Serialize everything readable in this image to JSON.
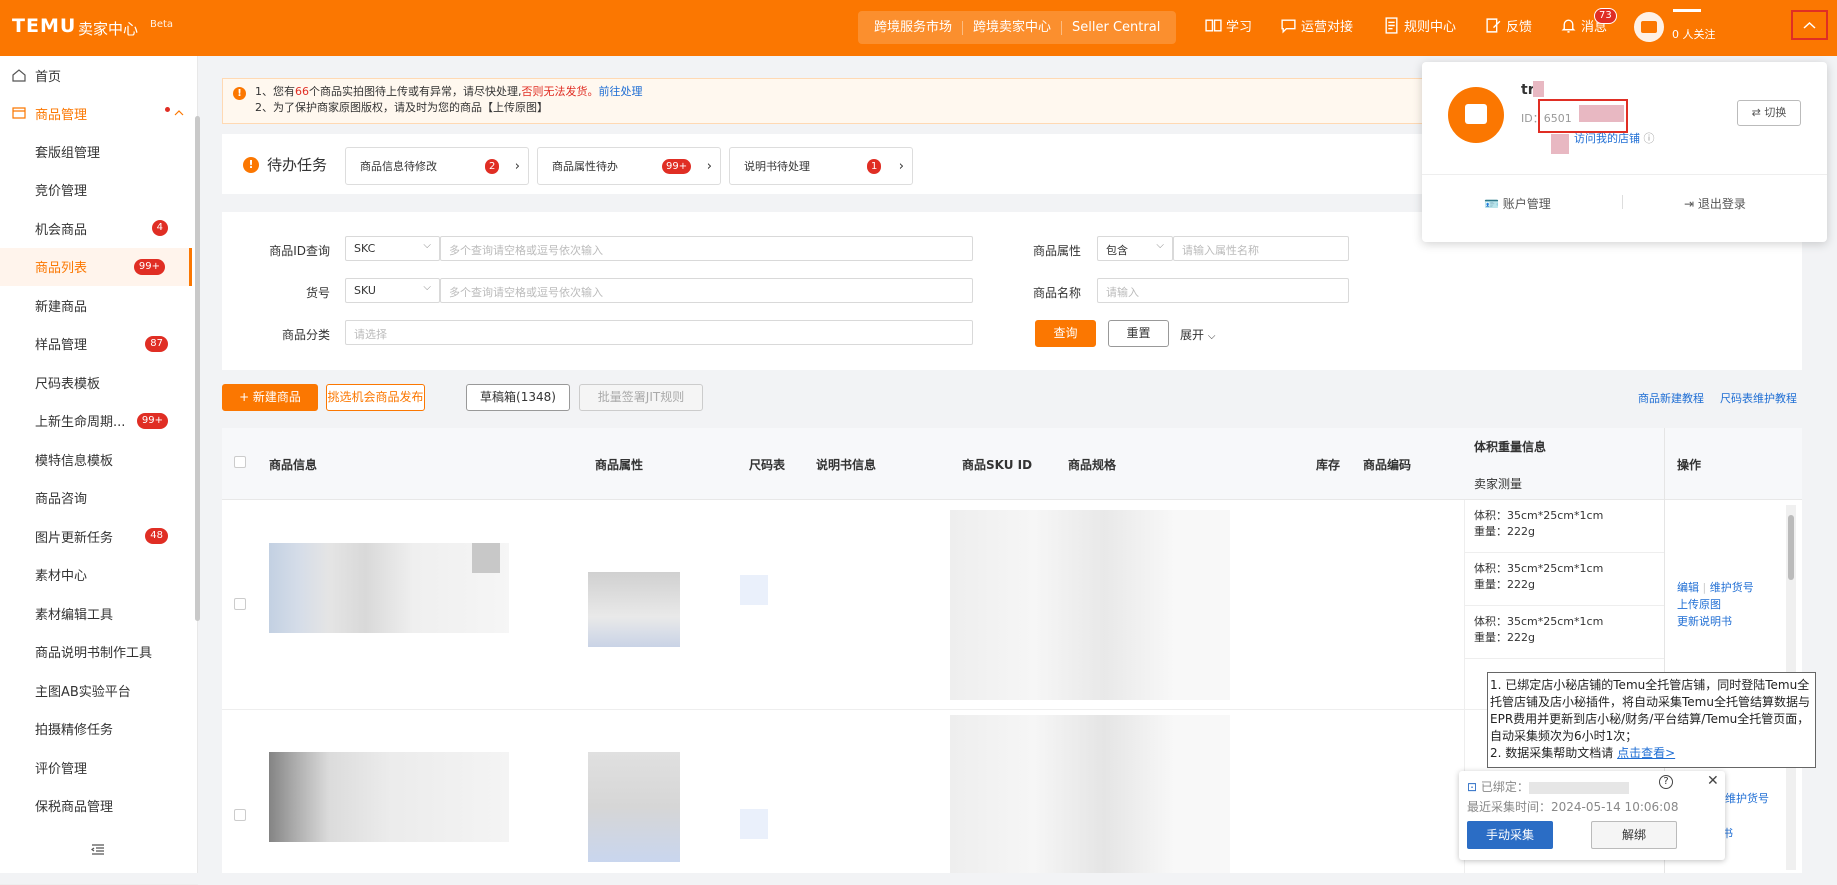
{
  "header": {
    "brand": "TEMU",
    "brand_sub": "卖家中心",
    "beta": "Beta",
    "links": [
      "跨境服务市场",
      "跨境卖家中心",
      "Seller Central"
    ],
    "nav": {
      "learn": "学习",
      "ops": "运营对接",
      "rules": "规则中心",
      "feedback": "反馈",
      "messages": "消息",
      "messages_count": "73"
    },
    "follow": "0 人关注"
  },
  "sidebar": {
    "home": "首页",
    "group": "商品管理",
    "items": [
      {
        "label": "套版组管理",
        "badge": ""
      },
      {
        "label": "竞价管理",
        "badge": ""
      },
      {
        "label": "机会商品",
        "badge": "4"
      },
      {
        "label": "商品列表",
        "badge": "99+"
      },
      {
        "label": "新建商品",
        "badge": ""
      },
      {
        "label": "样品管理",
        "badge": "87"
      },
      {
        "label": "尺码表模板",
        "badge": ""
      },
      {
        "label": "上新生命周期...",
        "badge": "99+"
      },
      {
        "label": "模特信息模板",
        "badge": ""
      },
      {
        "label": "商品咨询",
        "badge": ""
      },
      {
        "label": "图片更新任务",
        "badge": "48"
      },
      {
        "label": "素材中心",
        "badge": ""
      },
      {
        "label": "素材编辑工具",
        "badge": ""
      },
      {
        "label": "商品说明书制作工具",
        "badge": ""
      },
      {
        "label": "主图AB实验平台",
        "badge": ""
      },
      {
        "label": "拍摄精修任务",
        "badge": ""
      },
      {
        "label": "评价管理",
        "badge": ""
      },
      {
        "label": "保税商品管理",
        "badge": ""
      }
    ]
  },
  "notice": {
    "line1_a": "1、您有",
    "line1_count": "66",
    "line1_b": "个商品实拍图待上传或有异常，请尽快处理,",
    "line1_warn": "否则无法发货。",
    "line1_link": "前往处理",
    "line2": "2、为了保护商家原图版权，请及时为您的商品【上传原图】"
  },
  "tasks": {
    "title": "待办任务",
    "items": [
      {
        "label": "商品信息待修改",
        "badge": "2"
      },
      {
        "label": "商品属性待办",
        "badge": "99+"
      },
      {
        "label": "说明书待处理",
        "badge": "1"
      }
    ]
  },
  "filters": {
    "id_label": "商品ID查询",
    "id_select": "SKC",
    "id_placeholder": "多个查询请空格或逗号依次输入",
    "sku_label": "货号",
    "sku_select": "SKU",
    "sku_placeholder": "多个查询请空格或逗号依次输入",
    "cat_label": "商品分类",
    "cat_placeholder": "请选择",
    "attr_label": "商品属性",
    "attr_select": "包含",
    "attr_placeholder": "请输入属性名称",
    "name_label": "商品名称",
    "name_placeholder": "请输入",
    "search": "查询",
    "reset": "重置",
    "expand": "展开"
  },
  "actions": {
    "new": "+ 新建商品",
    "opportunity": "挑选机会商品发布",
    "drafts": "草稿箱(1348)",
    "batch": "批量签署JIT规则",
    "tutorial": "商品新建教程",
    "size_tutorial": "尺码表维护教程"
  },
  "table": {
    "headers": {
      "info": "商品信息",
      "attr": "商品属性",
      "size": "尺码表",
      "manual": "说明书信息",
      "sku_id": "商品SKU ID",
      "spec": "商品规格",
      "stock": "库存",
      "code": "商品编码",
      "volume": "体积重量信息",
      "seller_measure": "卖家测量",
      "ops": "操作"
    },
    "volume_rows": [
      {
        "vol": "体积：35cm*25cm*1cm",
        "weight": "重量：222g"
      },
      {
        "vol": "体积：35cm*25cm*1cm",
        "weight": "重量：222g"
      },
      {
        "vol": "体积：35cm*25cm*1cm",
        "weight": "重量：222g"
      }
    ],
    "ops": {
      "edit": "编辑",
      "maintain": "维护货号",
      "upload": "上传原图",
      "update_manual": "更新说明书",
      "maintain2": "维护货号",
      "frag": "书"
    }
  },
  "popover": {
    "name": "tr",
    "id_prefix": "ID：6501",
    "visit": "访问我的店铺",
    "switch": "切换",
    "account": "账户管理",
    "logout": "退出登录"
  },
  "tooltip": {
    "line1": "1. 已绑定店小秘店铺的Temu全托管店铺，同时登陆Temu全托管店铺及店小秘插件，将自动采集Temu全托管结算数据与EPR费用并更新到店小秘/财务/平台结算/Temu全托管页面，自动采集频次为6小时1次；",
    "line2": "2. 数据采集帮助文档请",
    "line2_link": "点击查看>"
  },
  "widget": {
    "bound": "已绑定：",
    "time": "最近采集时间：2024-05-14 10:06:08",
    "collect": "手动采集",
    "unbind": "解绑"
  },
  "colors": {
    "brand": "#fb7701",
    "danger": "#e02e24",
    "link": "#1f6ed4"
  }
}
